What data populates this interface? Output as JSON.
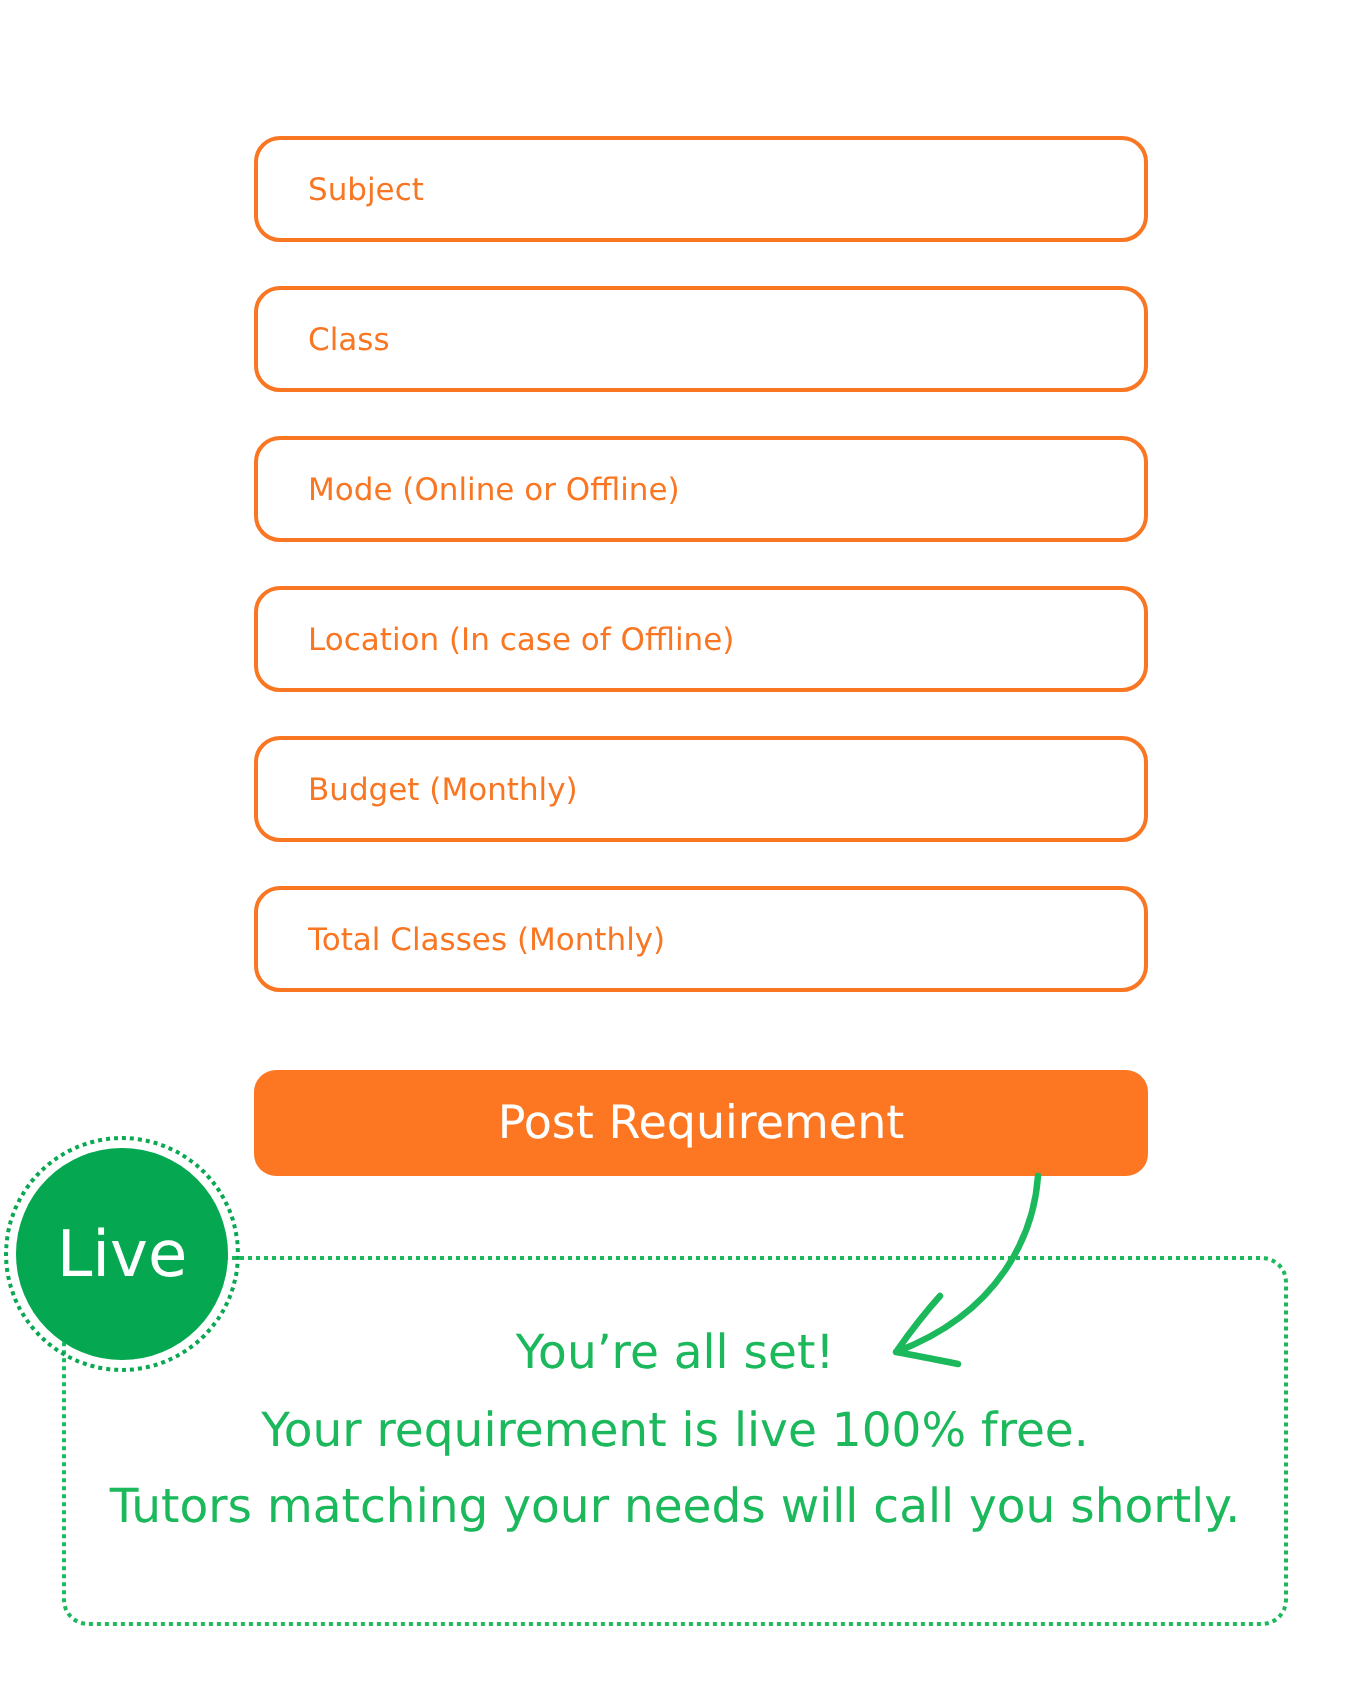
{
  "form": {
    "fields": [
      {
        "placeholder": "Subject"
      },
      {
        "placeholder": "Class"
      },
      {
        "placeholder": "Mode (Online or Offline)"
      },
      {
        "placeholder": "Location (In case of Offline)"
      },
      {
        "placeholder": "Budget (Monthly)"
      },
      {
        "placeholder": "Total Classes (Monthly)"
      }
    ],
    "submit_button": {
      "label": "Post Requirement"
    }
  },
  "status": {
    "badge": "Live",
    "message_lines": [
      "You’re all set!",
      "Your requirement is live 100% free.",
      "Tutors matching your needs will call you shortly."
    ]
  }
}
